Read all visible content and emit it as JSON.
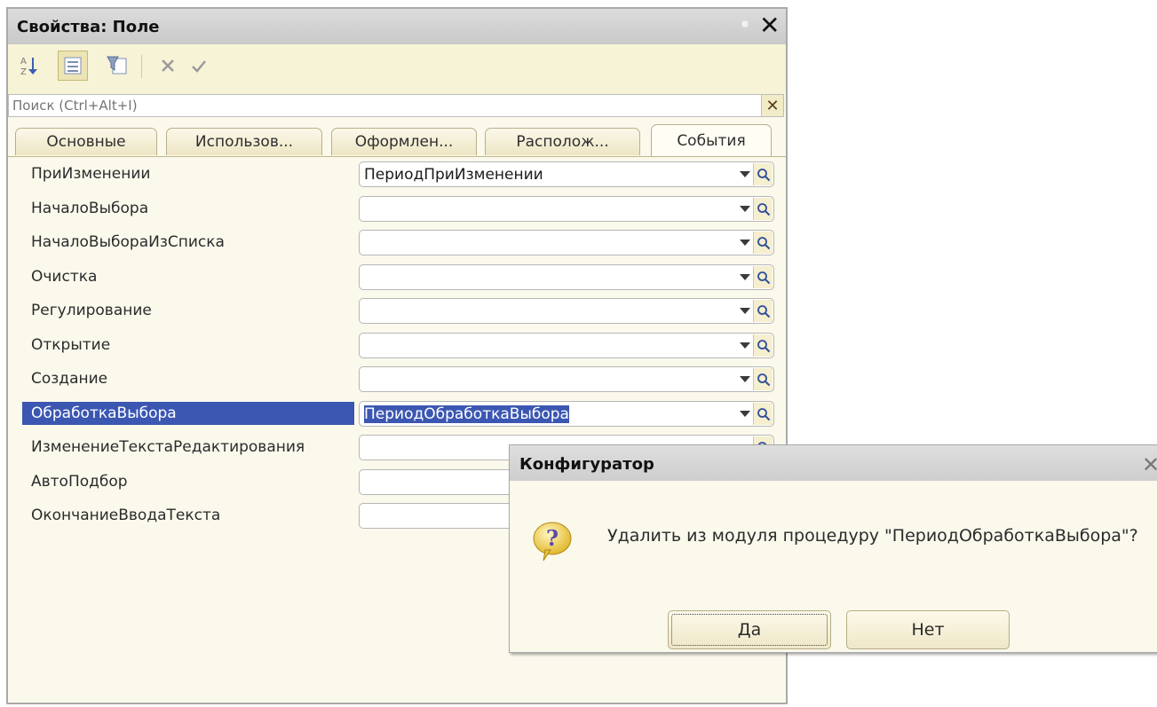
{
  "panel": {
    "title": "Свойства: Поле",
    "search_placeholder": "Поиск (Ctrl+Alt+I)",
    "tabs": [
      {
        "label": "Основные"
      },
      {
        "label": "Использов..."
      },
      {
        "label": "Оформлен..."
      },
      {
        "label": "Располож..."
      },
      {
        "label": "События"
      }
    ],
    "active_tab": "События",
    "rows": [
      {
        "label": "ПриИзменении",
        "value": "ПериодПриИзменении"
      },
      {
        "label": "НачалоВыбора",
        "value": ""
      },
      {
        "label": "НачалоВыбораИзСписка",
        "value": ""
      },
      {
        "label": "Очистка",
        "value": ""
      },
      {
        "label": "Регулирование",
        "value": ""
      },
      {
        "label": "Открытие",
        "value": ""
      },
      {
        "label": "Создание",
        "value": ""
      },
      {
        "label": "ОбработкаВыбора",
        "value": "ПериодОбработкаВыбора"
      },
      {
        "label": "ИзменениеТекстаРедактирования",
        "value": ""
      },
      {
        "label": "АвтоПодбор",
        "value": ""
      },
      {
        "label": "ОкончаниеВводаТекста",
        "value": ""
      }
    ],
    "selected_row": "ОбработкаВыбора"
  },
  "dialog": {
    "title": "Конфигуратор",
    "message": "Удалить из модуля процедуру \"ПериодОбработкаВыбора\"?",
    "yes_label": "Да",
    "no_label": "Нет"
  },
  "colors": {
    "selection": "#3b57b2",
    "panel_bg": "#fbf9ec",
    "toolbar_bg": "#f7f3d6"
  }
}
